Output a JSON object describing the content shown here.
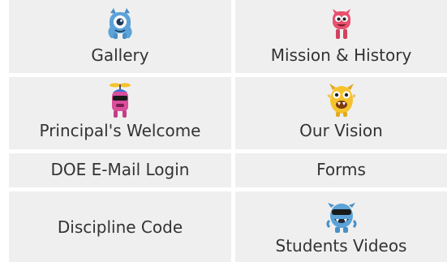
{
  "tiles": [
    {
      "label": "Gallery",
      "icon": "blue-cyclops-monster-icon",
      "has_icon": true
    },
    {
      "label": "Mission & History",
      "icon": "pink-monster-icon",
      "has_icon": true
    },
    {
      "label": "Principal's Welcome",
      "icon": "propeller-hat-monster-icon",
      "has_icon": true
    },
    {
      "label": "Our Vision",
      "icon": "yellow-furry-monster-icon",
      "has_icon": true
    },
    {
      "label": "DOE E-Mail Login",
      "has_icon": false
    },
    {
      "label": "Forms",
      "has_icon": false
    },
    {
      "label": "Discipline Code",
      "has_icon": false
    },
    {
      "label": "Students Videos",
      "icon": "blue-sunglasses-monster-icon",
      "has_icon": true
    }
  ],
  "colors": {
    "tile_bg": "#efefef",
    "text": "#333333",
    "blue_monster": "#5ba3d8",
    "pink_monster": "#e8506e",
    "yellow_monster": "#f5c22b"
  }
}
